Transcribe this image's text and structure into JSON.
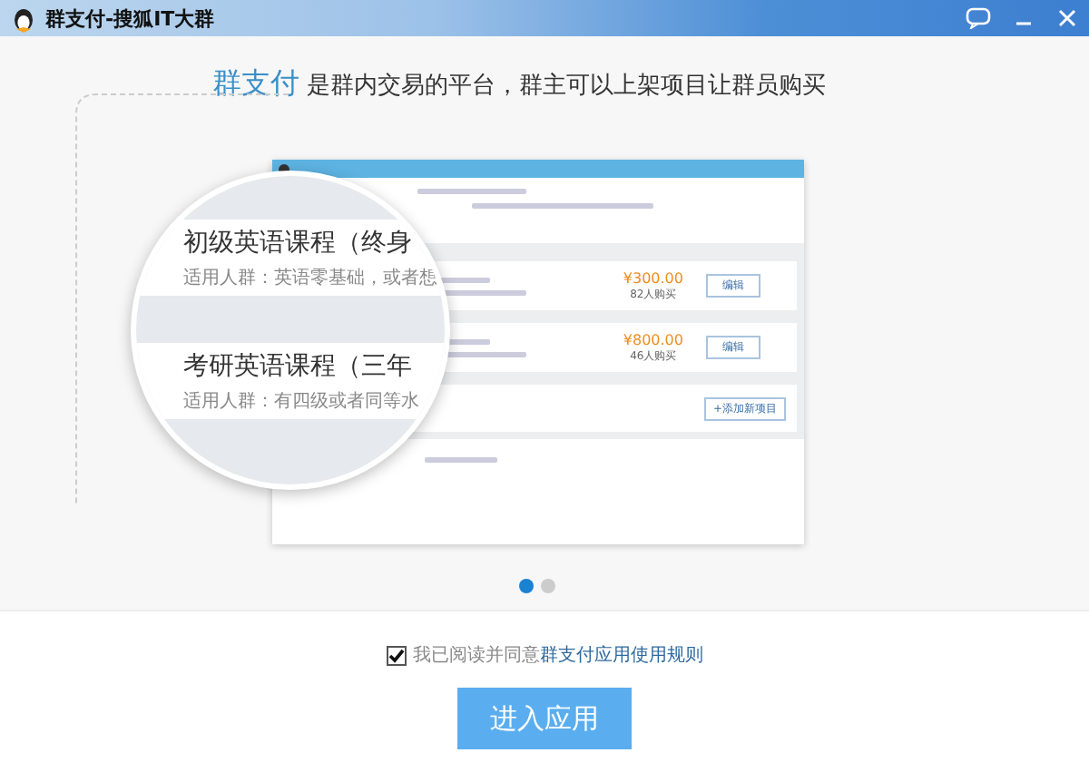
{
  "window": {
    "title": "群支付-搜狐IT大群"
  },
  "headline": {
    "brand": "群支付",
    "text": "是群内交易的平台，群主可以上架项目让群员购买"
  },
  "preview": {
    "items": [
      {
        "price": "¥300.00",
        "buyers": "82人购买",
        "action": "编辑"
      },
      {
        "price": "¥800.00",
        "buyers": "46人购买",
        "action": "编辑"
      }
    ],
    "add_button": "+添加新项目"
  },
  "magnifier": {
    "items": [
      {
        "title": "初级英语课程（终身",
        "audience": "适用人群：英语零基础，或者想"
      },
      {
        "title": "考研英语课程（三年",
        "audience": "适用人群：有四级或者同等水"
      }
    ]
  },
  "pager": [
    {
      "selected": true
    },
    {
      "selected": false
    }
  ],
  "agreement": {
    "checked": true,
    "text": "我已阅读并同意",
    "link": "群支付应用使用规则"
  },
  "enter_button": "进入应用"
}
